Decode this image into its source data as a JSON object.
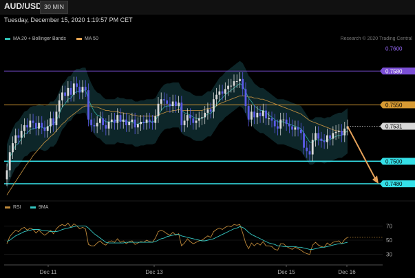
{
  "header": {
    "symbol": "AUD/USD",
    "timeframe": "30 MIN",
    "datetime": "Tuesday, December 15, 2020 1:19:57 PM CET"
  },
  "legend": {
    "ma_bb": {
      "label": "MA 20 + Bollinger Bands",
      "color": "#2fbfb3"
    },
    "ma50": {
      "label": "MA 50",
      "color": "#e8a654"
    },
    "credit": "Research © 2020 Trading Central"
  },
  "rsi_legend": {
    "rsi": {
      "label": "RSI",
      "color": "#c08a3a"
    },
    "ma9": {
      "label": "9MA",
      "color": "#35c7c2"
    }
  },
  "colors": {
    "up": "#d9d9d9",
    "down": "#5b5be8",
    "band_fill": "#0e2a2e",
    "arrow": "#e6a25a"
  },
  "chart_data": [
    {
      "type": "candlestick",
      "title": "AUD/USD 30 MIN",
      "y_axis_labels": [
        "0.7600",
        "0.7580",
        "0.7550",
        "0.7531",
        "0.7500",
        "0.7480"
      ],
      "ylim": [
        0.7466,
        0.7604
      ],
      "x_axis_labels": [
        "Dec 11",
        "Dec 13",
        "Dec 15",
        "Dec 16"
      ],
      "levels": [
        {
          "value": 0.76,
          "label": "0.7600",
          "color": "#9b6bff",
          "style": "label-only"
        },
        {
          "value": 0.758,
          "label": "0.7580",
          "color": "#7b4fd6",
          "style": "line"
        },
        {
          "value": 0.755,
          "label": "0.7550",
          "color": "#d79a33",
          "style": "line"
        },
        {
          "value": 0.7531,
          "label": "0.7531",
          "color": "#d8d8d8",
          "style": "dotted-current"
        },
        {
          "value": 0.75,
          "label": "0.7500",
          "color": "#35e0e8",
          "style": "line"
        },
        {
          "value": 0.748,
          "label": "0.7480",
          "color": "#35e0e8",
          "style": "line"
        }
      ],
      "closes": [
        0.7492,
        0.7508,
        0.7516,
        0.7523,
        0.7521,
        0.7527,
        0.7532,
        0.753,
        0.7536,
        0.7534,
        0.7529,
        0.7534,
        0.753,
        0.7527,
        0.7531,
        0.7538,
        0.7532,
        0.7544,
        0.7554,
        0.7561,
        0.7558,
        0.7565,
        0.7559,
        0.7569,
        0.7566,
        0.7561,
        0.7566,
        0.7563,
        0.7537,
        0.7532,
        0.7531,
        0.7534,
        0.7538,
        0.7532,
        0.7529,
        0.7535,
        0.7537,
        0.7534,
        0.7541,
        0.7535,
        0.7537,
        0.7532,
        0.7535,
        0.7537,
        0.753,
        0.7533,
        0.7535,
        0.7534,
        0.7537,
        0.7535,
        0.7534,
        0.754,
        0.7551,
        0.7555,
        0.7554,
        0.7551,
        0.7549,
        0.7553,
        0.7549,
        0.7552,
        0.7532,
        0.7536,
        0.7541,
        0.7538,
        0.7534,
        0.7536,
        0.7538,
        0.7539,
        0.7543,
        0.7546,
        0.7544,
        0.7555,
        0.7559,
        0.7562,
        0.756,
        0.7564,
        0.7567,
        0.7567,
        0.7571,
        0.7571,
        0.7573,
        0.7564,
        0.7549,
        0.7537,
        0.7544,
        0.7539,
        0.7543,
        0.754,
        0.7545,
        0.7538,
        0.7538,
        0.7536,
        0.7531,
        0.7529,
        0.7537,
        0.7537,
        0.7533,
        0.7531,
        0.7528,
        0.753,
        0.7528,
        0.7525,
        0.7512,
        0.7509,
        0.7506,
        0.7519,
        0.7525,
        0.752,
        0.7518,
        0.7517,
        0.7523,
        0.752,
        0.7525,
        0.7526,
        0.7527,
        0.7523,
        0.7529,
        0.7531
      ],
      "ma20": [
        0.7495,
        0.7503,
        0.7509,
        0.7514,
        0.7516,
        0.752,
        0.7524,
        0.7525,
        0.7528,
        0.7529,
        0.7529,
        0.7531,
        0.753,
        0.7529,
        0.753,
        0.7533,
        0.7533,
        0.7536,
        0.7542,
        0.7548,
        0.7551,
        0.7555,
        0.7556,
        0.756,
        0.7562,
        0.7562,
        0.7563,
        0.7563,
        0.7555,
        0.7549,
        0.7544,
        0.7541,
        0.754,
        0.7537,
        0.7535,
        0.7535,
        0.7535,
        0.7535,
        0.7537,
        0.7536,
        0.7536,
        0.7535,
        0.7535,
        0.7535,
        0.7533,
        0.7533,
        0.7534,
        0.7534,
        0.7535,
        0.7535,
        0.7535,
        0.7536,
        0.7541,
        0.7545,
        0.7548,
        0.7549,
        0.7549,
        0.755,
        0.755,
        0.755,
        0.7545,
        0.7543,
        0.7542,
        0.7541,
        0.7539,
        0.7538,
        0.7538,
        0.7538,
        0.754,
        0.7542,
        0.7542,
        0.7546,
        0.755,
        0.7554,
        0.7556,
        0.7559,
        0.7561,
        0.7563,
        0.7565,
        0.7567,
        0.7569,
        0.7567,
        0.7562,
        0.7556,
        0.7553,
        0.7549,
        0.7547,
        0.7545,
        0.7545,
        0.7543,
        0.7541,
        0.7539,
        0.7537,
        0.7535,
        0.7535,
        0.7535,
        0.7534,
        0.7533,
        0.7532,
        0.7531,
        0.753,
        0.7529,
        0.7525,
        0.7521,
        0.7517,
        0.7517,
        0.7519,
        0.7519,
        0.7519,
        0.7518,
        0.7519,
        0.7519,
        0.7521,
        0.7522,
        0.7523,
        0.7523,
        0.7525,
        0.7527
      ],
      "ma50": [
        0.747,
        0.7474,
        0.7478,
        0.7482,
        0.7486,
        0.749,
        0.7494,
        0.7498,
        0.7501,
        0.7505,
        0.7508,
        0.7511,
        0.7514,
        0.7517,
        0.7519,
        0.7522,
        0.7524,
        0.7527,
        0.753,
        0.7533,
        0.7535,
        0.7538,
        0.754,
        0.7542,
        0.7544,
        0.7546,
        0.7548,
        0.7549,
        0.7549,
        0.7549,
        0.7548,
        0.7548,
        0.7547,
        0.7546,
        0.7545,
        0.7545,
        0.7544,
        0.7544,
        0.7544,
        0.7543,
        0.7543,
        0.7542,
        0.7542,
        0.7541,
        0.7541,
        0.754,
        0.754,
        0.754,
        0.754,
        0.754,
        0.754,
        0.754,
        0.7541,
        0.7542,
        0.7543,
        0.7544,
        0.7544,
        0.7545,
        0.7545,
        0.7546,
        0.7545,
        0.7545,
        0.7545,
        0.7545,
        0.7545,
        0.7545,
        0.7545,
        0.7545,
        0.7546,
        0.7547,
        0.7547,
        0.7548,
        0.7549,
        0.7551,
        0.7552,
        0.7553,
        0.7554,
        0.7555,
        0.7556,
        0.7557,
        0.7558,
        0.7558,
        0.7558,
        0.7557,
        0.7557,
        0.7556,
        0.7556,
        0.7555,
        0.7555,
        0.7554,
        0.7553,
        0.7552,
        0.7551,
        0.755,
        0.7549,
        0.7548,
        0.7547,
        0.7546,
        0.7545,
        0.7544,
        0.7543,
        0.7542,
        0.754,
        0.7538,
        0.7536,
        0.7535,
        0.7534,
        0.7533,
        0.7532,
        0.7531,
        0.753,
        0.7529,
        0.7528,
        0.7527,
        0.7527,
        0.7526,
        0.7526,
        0.7526
      ],
      "band_width": 0.002,
      "forecast": {
        "from": 0.7531,
        "to": 0.748,
        "label": "0.7480"
      }
    },
    {
      "type": "line",
      "title": "RSI",
      "y_axis_labels": [
        "70",
        "50",
        "30"
      ],
      "ylim": [
        20,
        80
      ],
      "series": [
        {
          "name": "RSI",
          "color": "#c08a3a",
          "values": [
            45,
            55,
            60,
            64,
            62,
            66,
            68,
            64,
            67,
            65,
            60,
            64,
            60,
            57,
            60,
            64,
            59,
            66,
            70,
            72,
            70,
            74,
            68,
            73,
            70,
            66,
            68,
            66,
            44,
            42,
            42,
            46,
            49,
            45,
            43,
            48,
            49,
            47,
            52,
            47,
            49,
            45,
            48,
            49,
            44,
            46,
            48,
            47,
            50,
            48,
            47,
            53,
            62,
            64,
            62,
            59,
            57,
            61,
            57,
            59,
            42,
            46,
            52,
            48,
            45,
            47,
            49,
            50,
            53,
            56,
            54,
            62,
            65,
            67,
            65,
            68,
            70,
            69,
            72,
            71,
            72,
            60,
            46,
            38,
            46,
            42,
            46,
            43,
            48,
            42,
            42,
            41,
            37,
            36,
            45,
            45,
            41,
            39,
            37,
            40,
            38,
            36,
            33,
            31,
            30,
            43,
            47,
            43,
            41,
            40,
            46,
            43,
            47,
            48,
            49,
            45,
            51,
            54
          ]
        },
        {
          "name": "9MA",
          "color": "#35c7c2",
          "values": [
            48,
            50,
            53,
            56,
            58,
            60,
            62,
            63,
            64,
            65,
            65,
            65,
            64,
            63,
            63,
            62,
            62,
            62,
            63,
            65,
            66,
            67,
            68,
            69,
            70,
            70,
            70,
            70,
            67,
            63,
            59,
            56,
            53,
            50,
            47,
            46,
            46,
            46,
            46,
            46,
            46,
            47,
            47,
            47,
            47,
            47,
            47,
            47,
            47,
            47,
            47,
            48,
            50,
            52,
            53,
            55,
            56,
            57,
            58,
            58,
            56,
            55,
            54,
            53,
            52,
            51,
            50,
            49,
            49,
            50,
            51,
            52,
            54,
            56,
            58,
            60,
            62,
            64,
            66,
            67,
            69,
            68,
            65,
            61,
            58,
            56,
            54,
            52,
            50,
            48,
            46,
            45,
            44,
            42,
            42,
            41,
            41,
            41,
            41,
            41,
            40,
            40,
            39,
            38,
            37,
            37,
            38,
            39,
            40,
            40,
            41,
            42,
            43,
            44,
            45,
            45,
            46,
            47
          ]
        }
      ]
    }
  ]
}
